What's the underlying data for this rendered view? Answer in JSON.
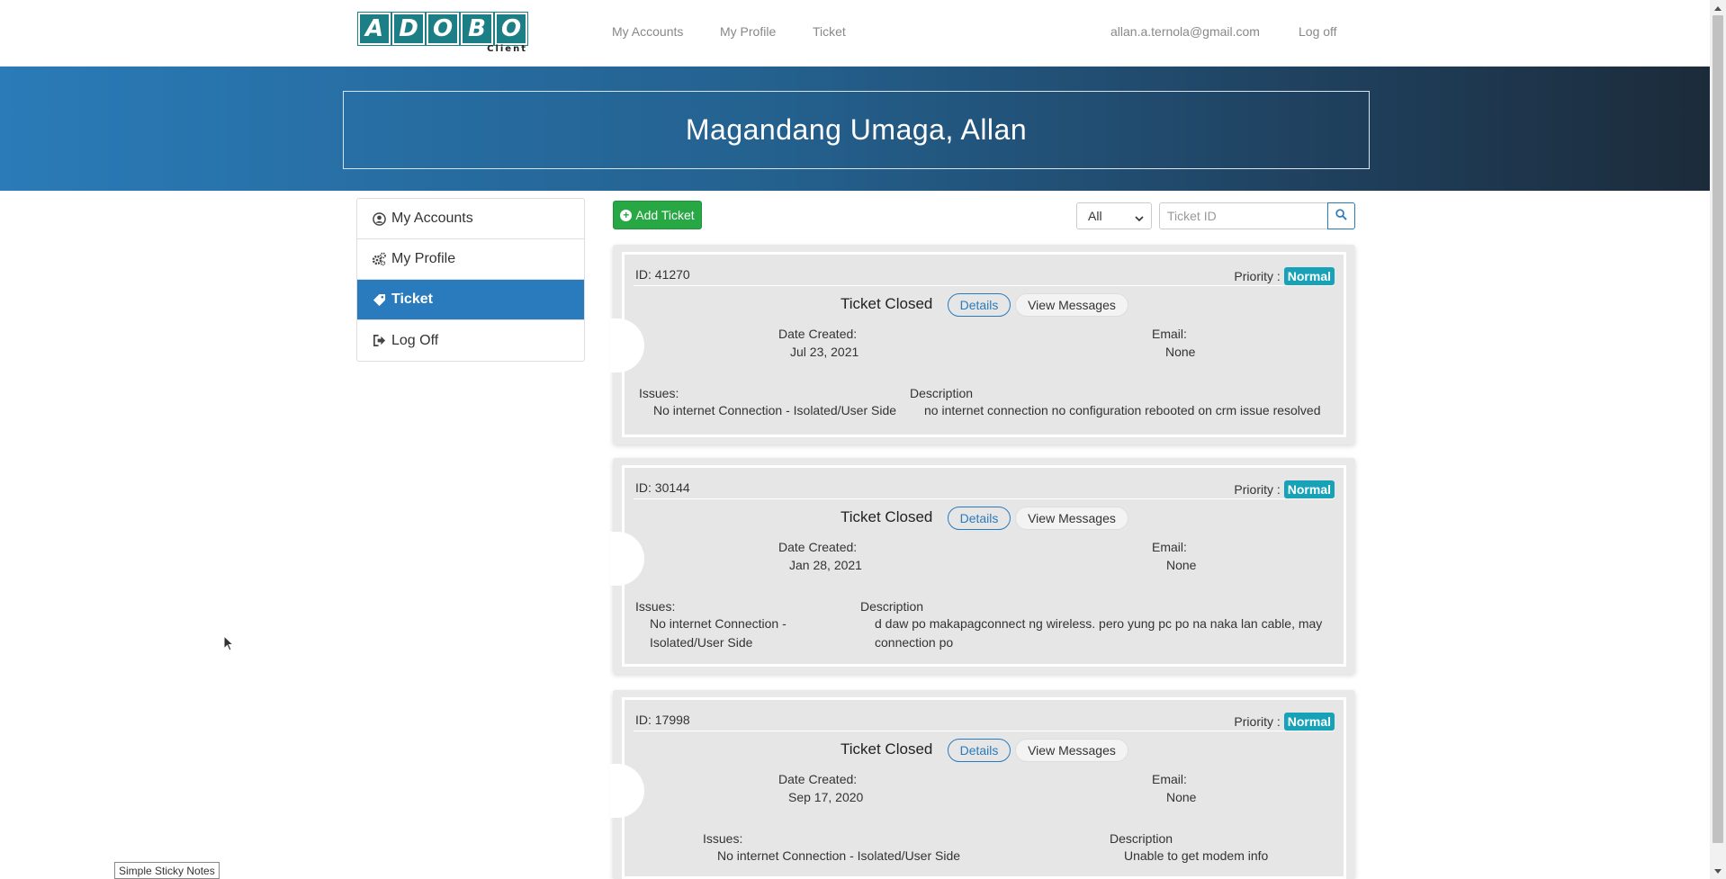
{
  "header": {
    "logo_letters": [
      "A",
      "D",
      "O",
      "B",
      "O"
    ],
    "logo_sub": "Client",
    "nav": [
      "My Accounts",
      "My Profile",
      "Ticket"
    ],
    "user_email": "allan.a.ternola@gmail.com",
    "logoff": "Log off"
  },
  "banner": {
    "greeting": "Magandang Umaga, Allan"
  },
  "sidebar": {
    "items": [
      {
        "label": "My Accounts",
        "icon": "user-circle-icon"
      },
      {
        "label": "My Profile",
        "icon": "cogs-icon"
      },
      {
        "label": "Ticket",
        "icon": "tag-icon",
        "active": true
      },
      {
        "label": "Log Off",
        "icon": "sign-out-icon"
      }
    ]
  },
  "toolbar": {
    "add_label": "Add Ticket",
    "filter_value": "All",
    "search_placeholder": "Ticket ID"
  },
  "tickets": [
    {
      "id": "ID: 41270",
      "priority_label": "Priority :",
      "priority": "Normal",
      "status": "Ticket Closed",
      "details_label": "Details",
      "messages_label": "View Messages",
      "date_label": "Date Created:",
      "date": "Jul 23, 2021",
      "email_label": "Email:",
      "email": "None",
      "issues_label": "Issues:",
      "issues": "No internet Connection - Isolated/User Side",
      "desc_label": "Description",
      "description": "no internet connection no configuration rebooted on crm issue resolved"
    },
    {
      "id": "ID: 30144",
      "priority_label": "Priority :",
      "priority": "Normal",
      "status": "Ticket Closed",
      "details_label": "Details",
      "messages_label": "View Messages",
      "date_label": "Date Created:",
      "date": "Jan 28, 2021",
      "email_label": "Email:",
      "email": "None",
      "issues_label": "Issues:",
      "issues_line1": "No internet Connection -",
      "issues_line2": "Isolated/User Side",
      "desc_label": "Description",
      "desc_line1": "d daw po makapagconnect ng wireless. pero yung pc po na naka lan cable, may",
      "desc_line2": "connection po"
    },
    {
      "id": "ID: 17998",
      "priority_label": "Priority :",
      "priority": "Normal",
      "status": "Ticket Closed",
      "details_label": "Details",
      "messages_label": "View Messages",
      "date_label": "Date Created:",
      "date": "Sep 17, 2020",
      "email_label": "Email:",
      "email": "None",
      "issues_label": "Issues:",
      "issues": "No internet Connection - Isolated/User Side",
      "desc_label": "Description",
      "description": "Unable to get modem info"
    }
  ],
  "taskbar": {
    "sticky_notes": "Simple Sticky Notes"
  },
  "colors": {
    "brand_teal": "#1c7f86",
    "primary_blue": "#2a7bbd",
    "success_green": "#28a745",
    "badge_info": "#17a2b8"
  }
}
